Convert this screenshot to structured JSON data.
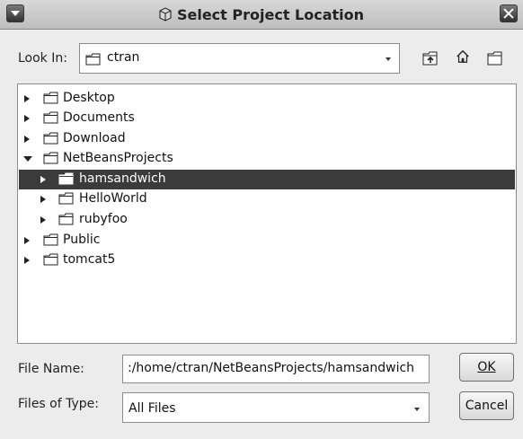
{
  "window": {
    "title": "Select Project Location"
  },
  "look_in": {
    "label": "Look In:",
    "value": "ctran"
  },
  "toolbar": {
    "icons": [
      "up-folder-icon",
      "home-icon",
      "new-folder-icon"
    ]
  },
  "tree": [
    {
      "name": "Desktop",
      "expanded": false,
      "selected": false,
      "level": 0
    },
    {
      "name": "Documents",
      "expanded": false,
      "selected": false,
      "level": 0
    },
    {
      "name": "Download",
      "expanded": false,
      "selected": false,
      "level": 0
    },
    {
      "name": "NetBeansProjects",
      "expanded": true,
      "selected": false,
      "level": 0
    },
    {
      "name": "hamsandwich",
      "expanded": false,
      "selected": true,
      "level": 1
    },
    {
      "name": "HelloWorld",
      "expanded": false,
      "selected": false,
      "level": 1
    },
    {
      "name": "rubyfoo",
      "expanded": false,
      "selected": false,
      "level": 1
    },
    {
      "name": "Public",
      "expanded": false,
      "selected": false,
      "level": 0
    },
    {
      "name": "tomcat5",
      "expanded": false,
      "selected": false,
      "level": 0
    }
  ],
  "file_name": {
    "label": "File Name:",
    "value": ":/home/ctran/NetBeansProjects/hamsandwich"
  },
  "file_type": {
    "label": "Files of Type:",
    "value": "All Files"
  },
  "buttons": {
    "ok": "OK",
    "cancel": "Cancel"
  }
}
